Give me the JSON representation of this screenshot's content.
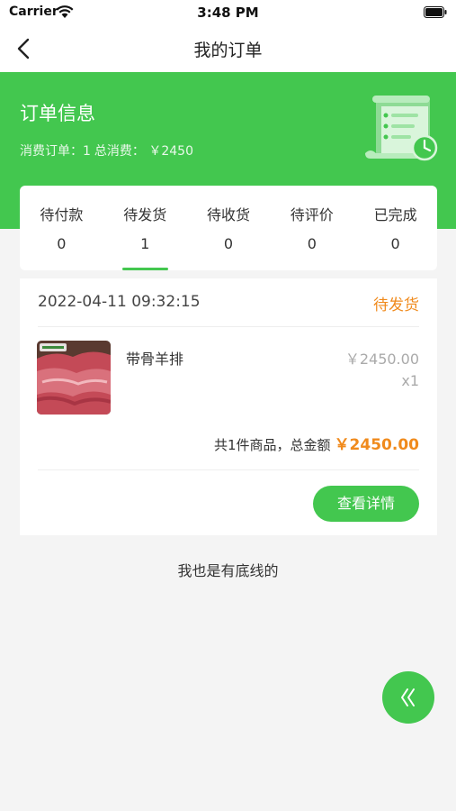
{
  "status_bar": {
    "carrier": "Carrier",
    "time": "3:48 PM"
  },
  "nav": {
    "title": "我的订单"
  },
  "banner": {
    "title": "订单信息",
    "order_count_label": "消费订单：1",
    "total_label": "总消费： ￥2450"
  },
  "tabs": [
    {
      "label": "待付款",
      "count": "0"
    },
    {
      "label": "待发货",
      "count": "1"
    },
    {
      "label": "待收货",
      "count": "0"
    },
    {
      "label": "待评价",
      "count": "0"
    },
    {
      "label": "已完成",
      "count": "0"
    }
  ],
  "active_tab_index": 1,
  "order": {
    "time": "2022-04-11 09:32:15",
    "status": "待发货",
    "product_name": "带骨羊排",
    "price": "￥2450.00",
    "quantity": "x1",
    "total_prefix": "共1件商品，总金额",
    "total_amount": "￥2450.00",
    "detail_button": "查看详情"
  },
  "footer": {
    "text": "我也是有底线的"
  },
  "colors": {
    "brand": "#43c74f",
    "accent": "#f08a1c"
  },
  "icons": {
    "back": "chevron-left-icon",
    "receipt": "receipt-clock-icon",
    "float": "double-chevron-left-icon"
  }
}
